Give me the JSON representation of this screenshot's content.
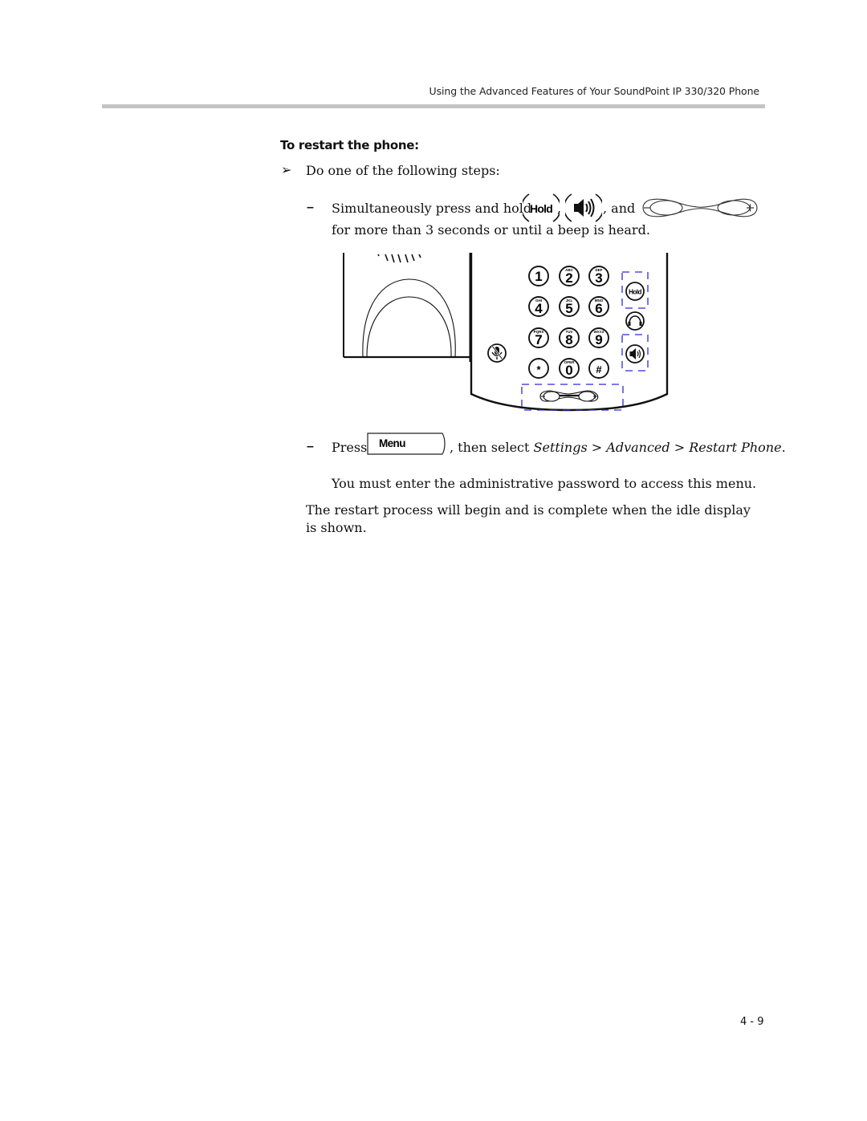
{
  "header": {
    "running_title": "Using the Advanced Features of Your SoundPoint IP 330/320 Phone"
  },
  "section": {
    "title": "To restart the phone:",
    "step_bullet_icon": "arrow-bullet-icon",
    "step_text": "Do one of the following steps:",
    "substeps": [
      {
        "bullet": "–",
        "text_before": "Simultaneously press and hold",
        "key1_label": "Hold",
        "sep1": ",",
        "key2_icon": "speaker-icon",
        "sep2": ", and",
        "key3_icon": "volume-rocker-icon",
        "line2": "for more than 3 seconds or until a beep is heard."
      },
      {
        "bullet": "–",
        "text_before": "Press",
        "softkey_label": "Menu",
        "text_after": ", then select",
        "path": [
          "Settings",
          "Advanced",
          "Restart Phone"
        ],
        "path_separator": ">",
        "end": ".",
        "note": "You must enter the administrative password to access this menu."
      }
    ],
    "result": "The restart process will begin and is complete when the idle display is shown."
  },
  "figure": {
    "keypad": [
      {
        "digit": "1",
        "letters": ""
      },
      {
        "digit": "2",
        "letters": "ABC"
      },
      {
        "digit": "3",
        "letters": "DEF"
      },
      {
        "digit": "4",
        "letters": "GHI"
      },
      {
        "digit": "5",
        "letters": "JKL"
      },
      {
        "digit": "6",
        "letters": "MNO"
      },
      {
        "digit": "7",
        "letters": "PQRS"
      },
      {
        "digit": "8",
        "letters": "TUV"
      },
      {
        "digit": "9",
        "letters": "WXYZ"
      },
      {
        "digit": "*",
        "letters": ""
      },
      {
        "digit": "0",
        "letters": "OPER"
      },
      {
        "digit": "#",
        "letters": ""
      }
    ],
    "hold_label": "Hold",
    "highlight_color": "#2b2bd6"
  },
  "footer": {
    "page_number": "4 - 9"
  }
}
